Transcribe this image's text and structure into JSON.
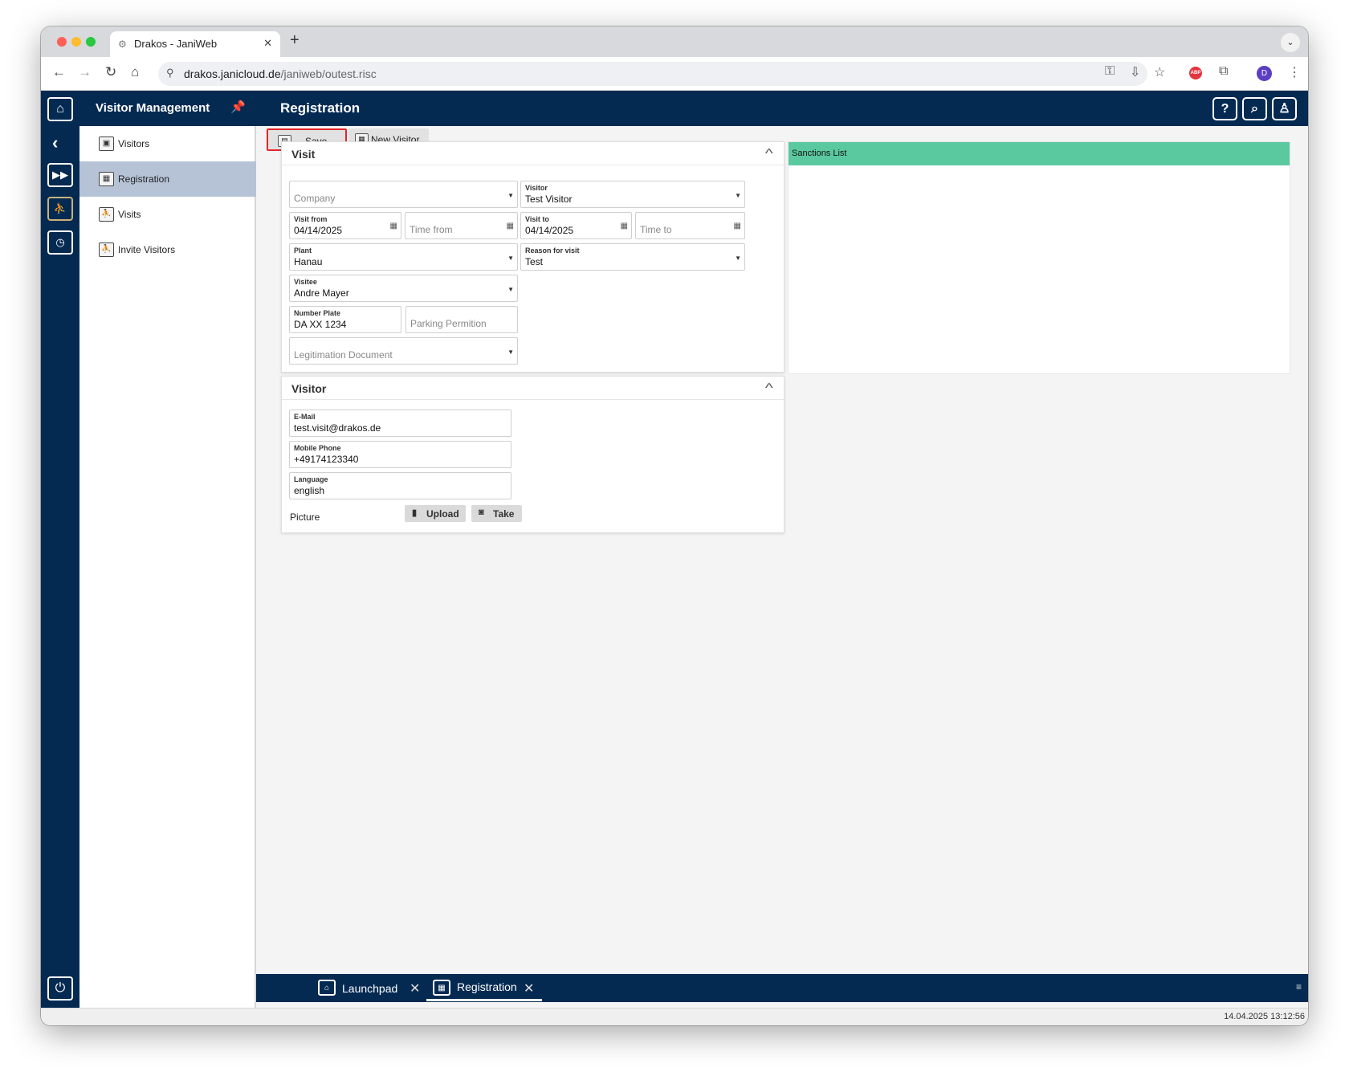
{
  "browser": {
    "tab_title": "Drakos - JaniWeb",
    "url_host": "drakos.janicloud.de",
    "url_path": "/janiweb/outest.risc",
    "profile_initial": "D"
  },
  "app": {
    "section_title": "Visitor Management",
    "page_title": "Registration"
  },
  "sidebar": {
    "items": [
      {
        "label": "Visitors",
        "active": false
      },
      {
        "label": "Registration",
        "active": true
      },
      {
        "label": "Visits",
        "active": false
      },
      {
        "label": "Invite Visitors",
        "active": false
      }
    ]
  },
  "toolbar": {
    "save_label": "Save",
    "new_visitor_label": "New Visitor"
  },
  "visit_panel": {
    "title": "Visit",
    "company": {
      "placeholder": "Company"
    },
    "visitor": {
      "label": "Visitor",
      "value": "Test Visitor"
    },
    "visit_from": {
      "label": "Visit from",
      "value": "04/14/2025"
    },
    "time_from": {
      "placeholder": "Time from"
    },
    "visit_to": {
      "label": "Visit to",
      "value": "04/14/2025"
    },
    "time_to": {
      "placeholder": "Time to"
    },
    "plant": {
      "label": "Plant",
      "value": "Hanau"
    },
    "reason": {
      "label": "Reason for visit",
      "value": "Test"
    },
    "visitee": {
      "label": "Visitee",
      "value": "Andre Mayer"
    },
    "number_plate": {
      "label": "Number Plate",
      "value": "DA XX 1234"
    },
    "parking": {
      "placeholder": "Parking Permition"
    },
    "legitimation": {
      "placeholder": "Legitimation Document"
    }
  },
  "visitor_panel": {
    "title": "Visitor",
    "email": {
      "label": "E-Mail",
      "value": "test.visit@drakos.de"
    },
    "mobile": {
      "label": "Mobile Phone",
      "value": "+49174123340"
    },
    "language": {
      "label": "Language",
      "value": "english"
    },
    "picture_label": "Picture",
    "upload_label": "Upload",
    "take_label": "Take"
  },
  "sanctions": {
    "title": "Sanctions List",
    "color": "#5bc9a0"
  },
  "bottom_tabs": [
    {
      "label": "Launchpad",
      "active": false
    },
    {
      "label": "Registration",
      "active": true
    }
  ],
  "status": {
    "timestamp": "14.04.2025 13:12:56"
  },
  "colors": {
    "primary": "#052a52",
    "highlight_border": "#e0262a",
    "active_nav": "#b6c3d6"
  }
}
